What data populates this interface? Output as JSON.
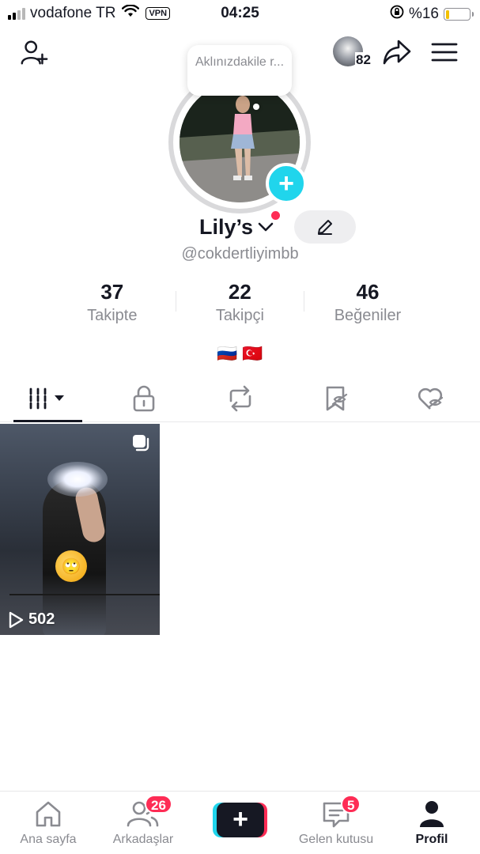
{
  "status_bar": {
    "carrier": "vodafone TR",
    "vpn": "VPN",
    "time": "04:25",
    "battery_percent": "%16",
    "battery_level": 0.16
  },
  "top_nav": {
    "left_icon": "add-friend-icon",
    "mini_avatar_count": "82",
    "icons": [
      "share-icon",
      "menu-icon"
    ]
  },
  "profile": {
    "note_bubble": "Aklınızdakile r...",
    "display_name": "Lily’s",
    "username": "@cokdertliyimbb",
    "bio": "🇷🇺 🇹🇷"
  },
  "stats": [
    {
      "value": "37",
      "label": "Takipte"
    },
    {
      "value": "22",
      "label": "Takipçi"
    },
    {
      "value": "46",
      "label": "Beğeniler"
    }
  ],
  "tabs": [
    "videos-grid-icon",
    "lock-icon",
    "repost-icon",
    "favorites-icon",
    "liked-icon"
  ],
  "videos": [
    {
      "views": "502"
    }
  ],
  "bottom_nav": {
    "home": "Ana sayfa",
    "friends": "Arkadaşlar",
    "friends_badge": "26",
    "create": "+",
    "inbox": "Gelen kutusu",
    "inbox_badge": "5",
    "profile": "Profil"
  },
  "colors": {
    "accent_red": "#fe2c55",
    "accent_cyan": "#20d5ec",
    "text_primary": "#161823",
    "text_secondary": "#8a8b91"
  }
}
